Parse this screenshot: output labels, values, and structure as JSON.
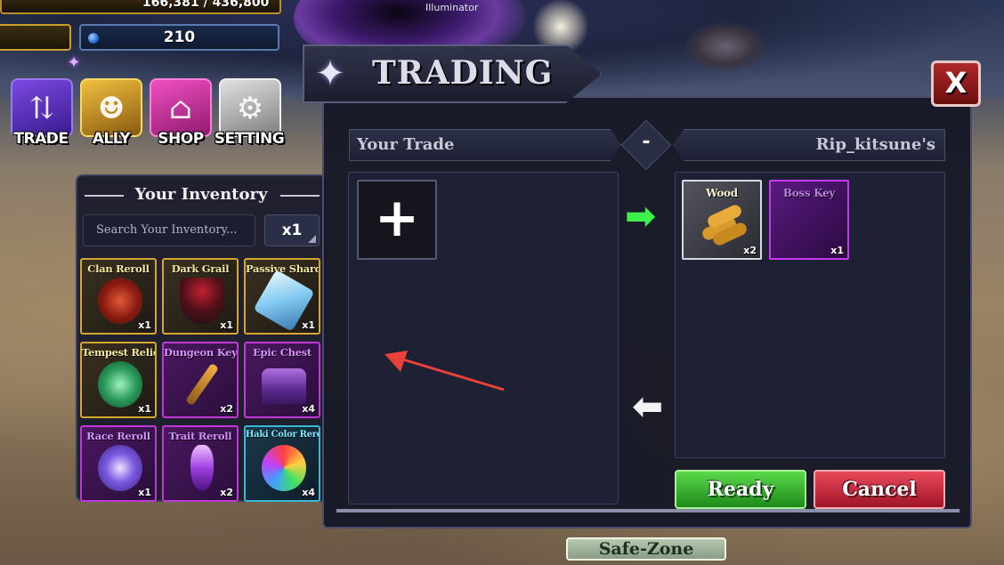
{
  "world": {
    "npc_label": "Illuminator"
  },
  "hud": {
    "xp_text": "166,381 / 436,800",
    "gems": "210",
    "menu": [
      {
        "label": "TRADE",
        "icon": "trade-icon"
      },
      {
        "label": "ALLY",
        "icon": "ally-icon"
      },
      {
        "label": "SHOP",
        "icon": "shop-icon"
      },
      {
        "label": "SETTING",
        "icon": "gear-icon"
      }
    ]
  },
  "inventory": {
    "title": "Your Inventory",
    "search_placeholder": "Search Your Inventory...",
    "quantity": "x1",
    "items": [
      {
        "name": "Clan Reroll",
        "count": "x1",
        "rarity": "gold"
      },
      {
        "name": "Dark Grail",
        "count": "x1",
        "rarity": "gold"
      },
      {
        "name": "Passive Shard",
        "count": "x1",
        "rarity": "gold"
      },
      {
        "name": "Tempest Relic",
        "count": "x1",
        "rarity": "gold"
      },
      {
        "name": "Dungeon Key",
        "count": "x2",
        "rarity": "purple"
      },
      {
        "name": "Epic Chest",
        "count": "x4",
        "rarity": "purple"
      },
      {
        "name": "Race Reroll",
        "count": "x1",
        "rarity": "purple"
      },
      {
        "name": "Trait Reroll",
        "count": "x2",
        "rarity": "purple"
      },
      {
        "name": "Haki Color Reroll",
        "count": "x4",
        "rarity": "cyan"
      }
    ]
  },
  "trade": {
    "title": "TRADING",
    "close_label": "X",
    "your_tab": "Your Trade",
    "divider": "-",
    "their_tab": "Rip_kitsune's",
    "add_label": "+",
    "their_items": [
      {
        "name": "Wood",
        "count": "x2"
      },
      {
        "name": "Boss Key",
        "count": "x1"
      }
    ],
    "ready_label": "Ready",
    "cancel_label": "Cancel"
  },
  "zone": {
    "label": "Safe-Zone"
  },
  "colors": {
    "ready": "#2ea42a",
    "cancel": "#c8283a",
    "accent_purple": "#c038d8",
    "accent_gold": "#d4a830"
  }
}
